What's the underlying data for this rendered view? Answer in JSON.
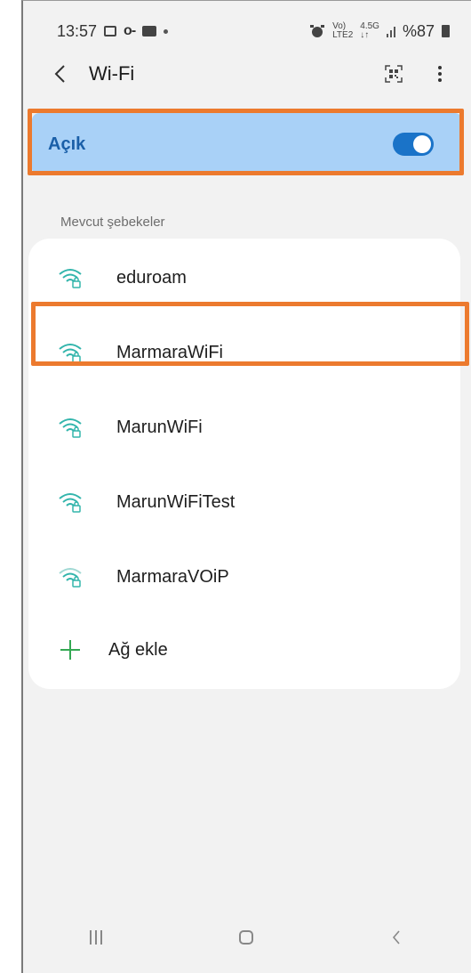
{
  "status_bar": {
    "time": "13:57",
    "net_top": "Vo)",
    "net_bottom": "LTE2",
    "signal_top": "4.5G",
    "signal_bottom": "↓↑",
    "battery": "%87"
  },
  "header": {
    "title": "Wi-Fi"
  },
  "wifi_toggle": {
    "label": "Açık",
    "on": true
  },
  "section_label": "Mevcut şebekeler",
  "networks": [
    {
      "name": "eduroam"
    },
    {
      "name": "MarmaraWiFi"
    },
    {
      "name": "MarunWiFi"
    },
    {
      "name": "MarunWiFiTest"
    },
    {
      "name": "MarmaraVOiP"
    }
  ],
  "add_network_label": "Ağ ekle",
  "colors": {
    "accent": "#1a73c8",
    "toggle_bg": "#a9d1f7",
    "highlight": "#ec7a2e",
    "wifi_icon": "#33b5ac"
  }
}
